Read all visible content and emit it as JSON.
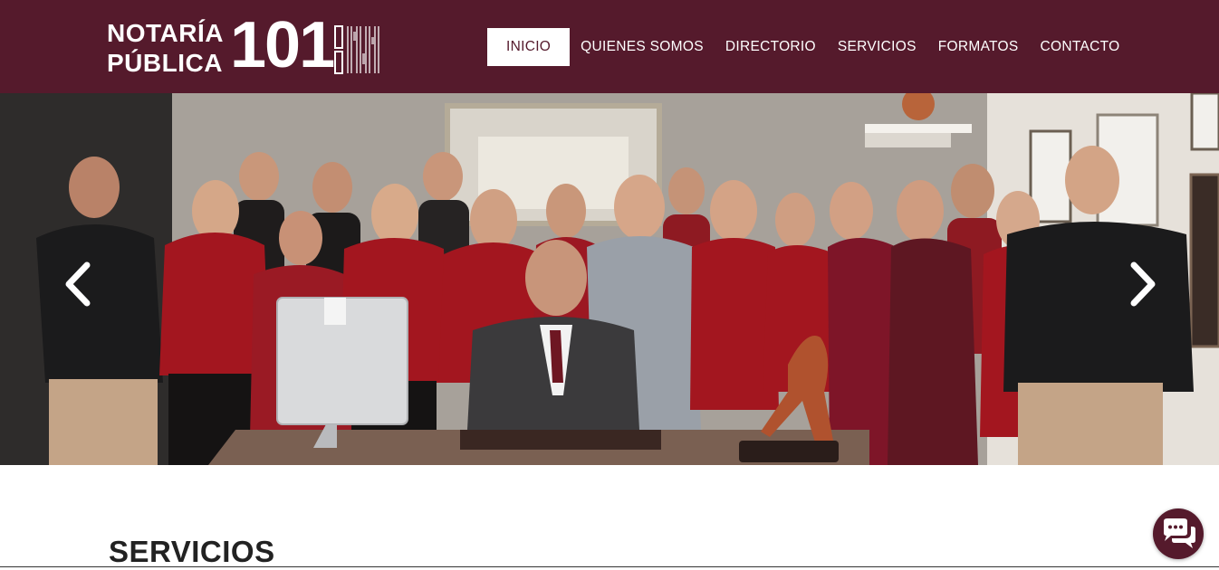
{
  "brand": {
    "line1": "NOTARÍA",
    "line2": "PÚBLICA",
    "number": "101",
    "color": "#551a2c"
  },
  "nav": {
    "items": [
      {
        "label": "INICIO",
        "active": true
      },
      {
        "label": "QUIENES SOMOS",
        "active": false
      },
      {
        "label": "DIRECTORIO",
        "active": false
      },
      {
        "label": "SERVICIOS",
        "active": false
      },
      {
        "label": "FORMATOS",
        "active": false
      },
      {
        "label": "CONTACTO",
        "active": false
      }
    ]
  },
  "hero": {
    "image": "team-photo",
    "prev_icon": "chevron-left-icon",
    "next_icon": "chevron-right-icon"
  },
  "section": {
    "title": "SERVICIOS"
  },
  "chat": {
    "icon": "chat-bubbles-icon"
  }
}
